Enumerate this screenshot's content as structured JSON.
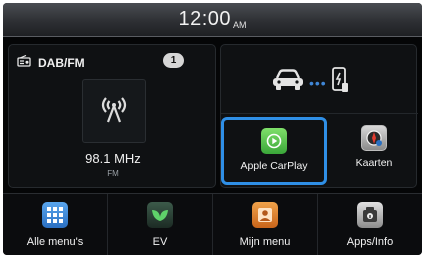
{
  "status": {
    "time": "12:00",
    "ampm": "AM"
  },
  "radio": {
    "title": "DAB/FM",
    "preset_badge": "1",
    "frequency": "98.1 MHz",
    "band": "FM",
    "source_icon": "radio-source-icon",
    "station_icon": "antenna-icon"
  },
  "phone_link": {
    "car_icon": "car-icon",
    "phone_icon": "phone-icon"
  },
  "apps": {
    "carplay_label": "Apple CarPlay",
    "maps_label": "Kaarten"
  },
  "bottom": {
    "items": [
      {
        "label": "Alle menu's",
        "icon": "grid-icon"
      },
      {
        "label": "EV",
        "icon": "leaf-icon"
      },
      {
        "label": "Mijn menu",
        "icon": "user-menu-icon"
      },
      {
        "label": "Apps/Info",
        "icon": "apps-info-icon"
      }
    ]
  },
  "colors": {
    "accent": "#2f8fe6",
    "background": "#050607"
  }
}
